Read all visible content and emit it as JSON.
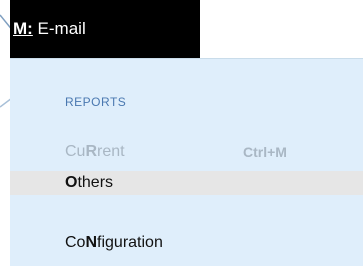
{
  "menu_tab": {
    "accel": "M:",
    "label": " E-mail"
  },
  "dropdown": {
    "section_header": "REPORTS",
    "items": [
      {
        "prefix": "Cu",
        "accel": "R",
        "suffix": "rent",
        "shortcut": "Ctrl+M",
        "state": "disabled"
      },
      {
        "prefix": "",
        "accel": "O",
        "suffix": "thers",
        "shortcut": "",
        "state": "highlighted"
      },
      {
        "prefix": "Co",
        "accel": "N",
        "suffix": "figuration",
        "shortcut": "",
        "state": "normal"
      }
    ]
  },
  "colors": {
    "tab_background": "#000000",
    "tab_text": "#ffffff",
    "dropdown_background": "#dfeefb",
    "section_header": "#4a78b0",
    "disabled_text": "#a9b7c4",
    "highlight_background": "#e6e6e6"
  }
}
